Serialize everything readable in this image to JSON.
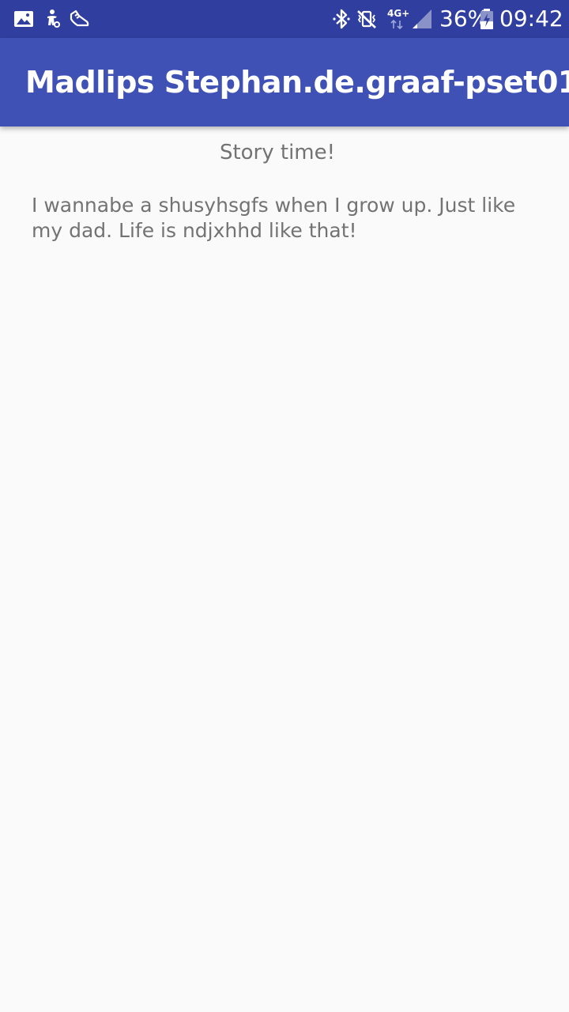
{
  "status_bar": {
    "icons_left": [
      "gallery-icon",
      "accessibility-icon",
      "running-shoe-icon"
    ],
    "icons_right": [
      "bluetooth-icon",
      "vibrate-mute-icon",
      "network-4g-icon",
      "signal-icon"
    ],
    "network_label": "4G+",
    "battery_percent": "36%",
    "time": "09:42",
    "colors": {
      "background": "#303f9f",
      "foreground": "#ffffff"
    }
  },
  "app_bar": {
    "title": "Madlips Stephan.de.graaf-pset01",
    "color": "#3f51b5"
  },
  "story": {
    "heading": "Story time!",
    "text": "I wannabe a shusyhsgfs when I grow up. Just like my dad. Life is ndjxhhd like that!"
  },
  "colors": {
    "page_background": "#fafafa",
    "text": "#737373"
  }
}
